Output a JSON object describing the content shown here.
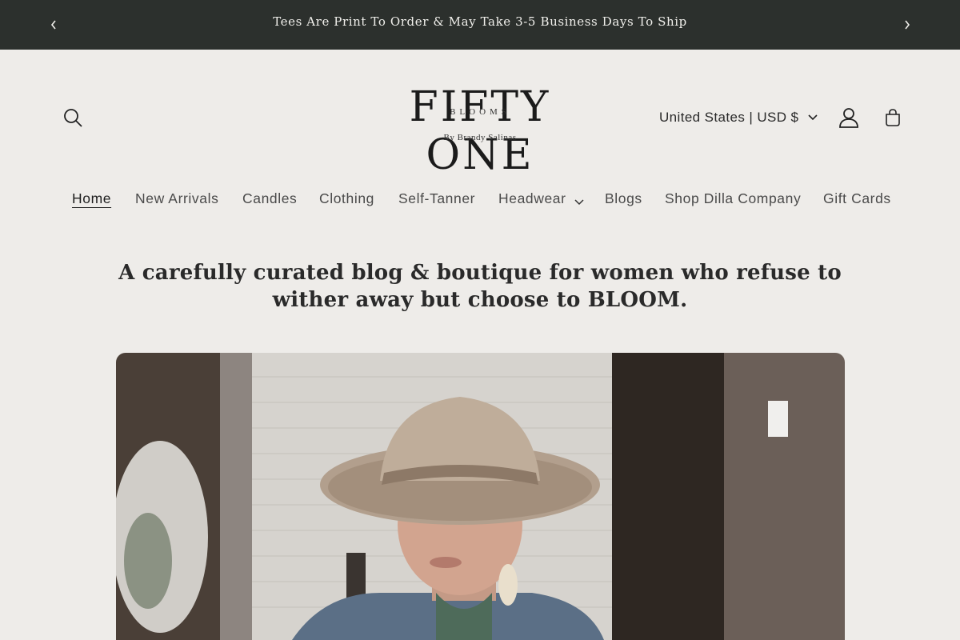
{
  "announcement": {
    "message": "Tees Are Print To Order & May Take 3-5 Business Days To Ship",
    "prev_icon": "chevron-left-icon",
    "next_icon": "chevron-right-icon"
  },
  "header": {
    "logo": {
      "wordmark": "FIFTY ONE",
      "subword": "BLOOMS",
      "byline": "By Brandy Salinas"
    },
    "country_selector": "United States | USD $",
    "icons": [
      "search-icon",
      "account-icon",
      "cart-icon",
      "chevron-down-icon"
    ]
  },
  "nav": {
    "items": [
      {
        "label": "Home",
        "active": true
      },
      {
        "label": "New Arrivals"
      },
      {
        "label": "Candles"
      },
      {
        "label": "Clothing"
      },
      {
        "label": "Self-Tanner"
      },
      {
        "label": "Headwear",
        "has_dropdown": true
      },
      {
        "label": "Blogs"
      },
      {
        "label": "Shop Dilla Company"
      },
      {
        "label": "Gift Cards"
      }
    ]
  },
  "main": {
    "tagline": "A carefully curated blog & boutique for women who refuse to wither away but choose to BLOOM."
  },
  "colors": {
    "announcement_bg": "#2c302d",
    "page_bg": "#eeece9",
    "text": "#222222"
  }
}
